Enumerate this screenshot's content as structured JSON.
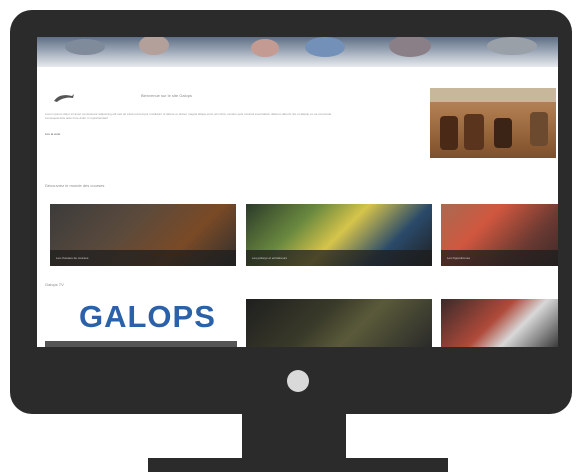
{
  "site": {
    "welcome": "Bienvenue sur le site Galops",
    "intro": "Lorem ipsum dolor sit amet consectetur adipiscing elit sed do eiusmod tempor incididunt ut labore et dolore magna aliqua enim ad minim veniam quis nostrud exercitation ullamco laboris nisi ut aliquip ex ea commodo consequat duis aute irure dolor in reprehenderit",
    "more_link": "Lire la suite",
    "section1_title": "Découvrez le monde des courses",
    "section2_title": "Galops TV",
    "cards_row1": [
      {
        "caption": "Les chevaux de courses"
      },
      {
        "caption": "Les jockeys et entraîneurs"
      },
      {
        "caption": "Les hippodromes"
      }
    ],
    "galops_logo": "GALOPS"
  },
  "colors": {
    "bezel": "#2b2b2b",
    "brand_blue": "#2b61a8",
    "hero": "#a87549"
  }
}
